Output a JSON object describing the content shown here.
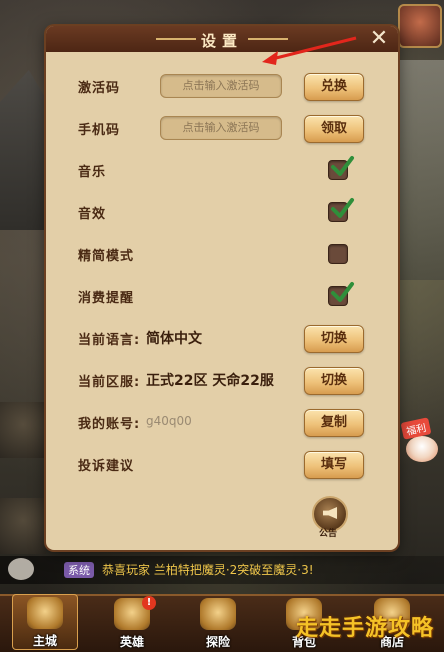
{
  "settings": {
    "title": "设置",
    "activation": {
      "label": "激活码",
      "placeholder": "点击输入激活码",
      "button": "兑换"
    },
    "phone": {
      "label": "手机码",
      "placeholder": "点击输入激活码",
      "button": "领取"
    },
    "music": {
      "label": "音乐",
      "checked": true
    },
    "sound": {
      "label": "音效",
      "checked": true
    },
    "simple_mode": {
      "label": "精简模式",
      "checked": false
    },
    "spend_reminder": {
      "label": "消费提醒",
      "checked": true
    },
    "language": {
      "label": "当前语言:",
      "value": "简体中文",
      "button": "切换"
    },
    "server": {
      "label": "当前区服:",
      "value": "正式22区 天命22服",
      "button": "切换"
    },
    "account": {
      "label": "我的账号:",
      "value": "g40q00",
      "button": "复制"
    },
    "feedback": {
      "label": "投诉建议",
      "button": "填写"
    },
    "notice": {
      "label": "公告"
    }
  },
  "chat": {
    "tag": "系统",
    "message": "恭喜玩家 兰柏特把魔灵·2突破至魔灵·3!"
  },
  "side": {
    "welfare": "福利"
  },
  "nav": [
    {
      "label": "主城",
      "active": true
    },
    {
      "label": "英雄",
      "badge": "!"
    },
    {
      "label": "探险"
    },
    {
      "label": "背包"
    },
    {
      "label": "商店"
    }
  ],
  "watermark": "走走手游攻略",
  "colors": {
    "panel": "#e3cfa8",
    "header": "#5a2e18",
    "button": "#eec27a",
    "check": "#2f8f3a"
  }
}
